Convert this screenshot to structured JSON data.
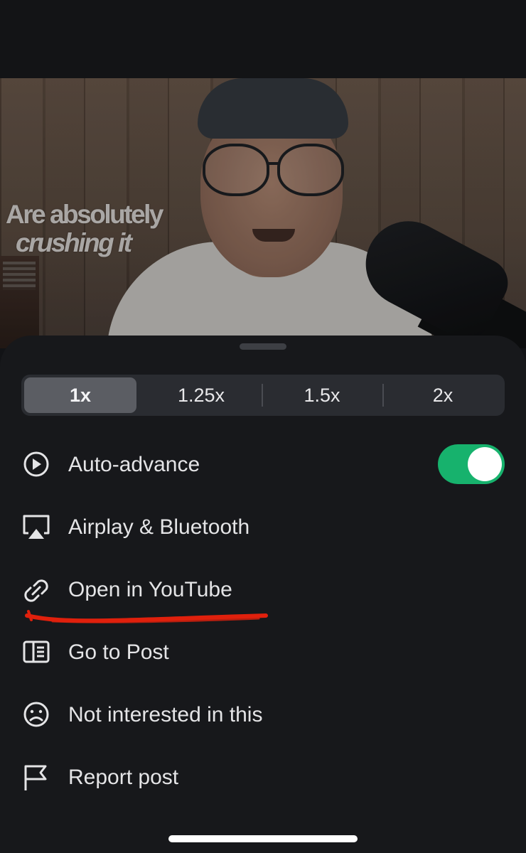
{
  "video": {
    "caption_line1": "Are absolutely",
    "caption_line2": "crushing it"
  },
  "speed_options": [
    {
      "label": "1x",
      "selected": true
    },
    {
      "label": "1.25x",
      "selected": false
    },
    {
      "label": "1.5x",
      "selected": false
    },
    {
      "label": "2x",
      "selected": false
    }
  ],
  "menu": {
    "auto_advance": {
      "label": "Auto-advance",
      "icon": "play-circle-icon",
      "toggle_on": true
    },
    "airplay": {
      "label": "Airplay & Bluetooth",
      "icon": "airplay-icon"
    },
    "open_youtube": {
      "label": "Open in YouTube",
      "icon": "link-icon"
    },
    "go_to_post": {
      "label": "Go to Post",
      "icon": "post-panel-icon"
    },
    "not_interested": {
      "label": "Not interested in this",
      "icon": "sad-face-icon"
    },
    "report": {
      "label": "Report post",
      "icon": "flag-icon"
    }
  },
  "colors": {
    "toggle_on": "#17b26d",
    "sheet_bg": "#17181b",
    "annotation": "#e0200c"
  }
}
